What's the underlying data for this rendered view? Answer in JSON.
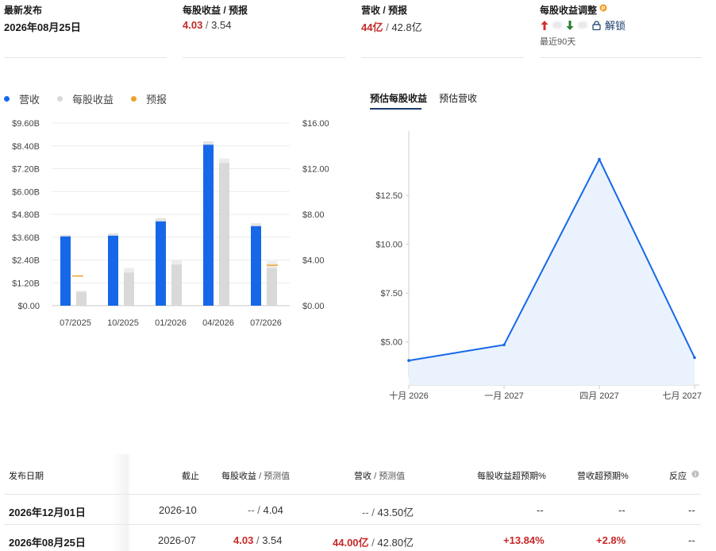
{
  "stats": {
    "latest": {
      "label": "最新发布",
      "value": "2026年08月25日"
    },
    "eps": {
      "label": "每股收益 / 预报",
      "actual": "4.03",
      "sep": " / ",
      "estimate": "3.54"
    },
    "revenue": {
      "label": "营收 / 预报",
      "actual": "44亿",
      "sep": " / ",
      "estimate": "42.8亿"
    },
    "revisions": {
      "label": "每股收益调整",
      "unlock": "解锁",
      "period": "最近90天"
    }
  },
  "legend": {
    "revenue": "营收",
    "eps": "每股收益",
    "forecast": "预报"
  },
  "colors": {
    "revenue": "#1668e8",
    "eps": "#d9d9d9",
    "forecast": "#f0a22e",
    "up": "#d32f2f",
    "down": "#2e7d32",
    "line": "#1668e8",
    "area": "#eaf2fd"
  },
  "tabs": [
    "预估每股收益",
    "预估营收"
  ],
  "chart_data": [
    {
      "type": "bar",
      "categories": [
        "07/2025",
        "10/2025",
        "01/2026",
        "04/2026",
        "07/2026"
      ],
      "left_axis": {
        "ticks": [
          "$0.00",
          "$1.20B",
          "$2.40B",
          "$3.60B",
          "$4.80B",
          "$6.00B",
          "$7.20B",
          "$8.40B",
          "$9.60B"
        ],
        "ylim": [
          0,
          9.6
        ]
      },
      "right_axis": {
        "ticks": [
          "$0.00",
          "$4.00",
          "$8.00",
          "$12.00",
          "$16.00"
        ],
        "ylim": [
          0,
          16
        ]
      },
      "series": [
        {
          "name": "营收",
          "axis": "left",
          "values": [
            3.64,
            3.68,
            4.43,
            8.46,
            4.18
          ],
          "estimates": [
            3.72,
            3.8,
            4.6,
            8.64,
            4.33
          ]
        },
        {
          "name": "每股收益",
          "axis": "right",
          "values": [
            1.2,
            2.9,
            3.6,
            12.5,
            3.3
          ],
          "estimates": [
            1.3,
            3.3,
            4.0,
            12.9,
            3.9
          ]
        },
        {
          "name": "预报",
          "axis": "right",
          "values": [
            2.6,
            null,
            null,
            null,
            3.54
          ]
        }
      ]
    },
    {
      "type": "area",
      "x": [
        "十月 2026",
        "一月 2027",
        "四月 2027",
        "七月 2027"
      ],
      "y": [
        4.05,
        4.85,
        14.35,
        4.2
      ],
      "y_ticks": [
        "$5.00",
        "$7.50",
        "$10.00",
        "$12.50"
      ],
      "ylim": [
        3.2,
        15.8
      ]
    }
  ],
  "table": {
    "headers": {
      "date": "发布日期",
      "period": "截止",
      "eps": "每股收益",
      "eps_est": "预测值",
      "rev": "营收",
      "rev_est": "预测值",
      "eps_surprise": "每股收益超预期%",
      "rev_surprise": "营收超预期%",
      "reaction": "反应"
    },
    "slash": "/",
    "rows": [
      {
        "date": "2026年12月01日",
        "period": "2026-10",
        "eps": "--",
        "eps_est": "4.04",
        "rev": "--",
        "rev_est": "43.50亿",
        "eps_surprise": "--",
        "rev_surprise": "--",
        "reaction": "--"
      },
      {
        "date": "2026年08月25日",
        "period": "2026-07",
        "eps": "4.03",
        "eps_est": "3.54",
        "rev": "44.00亿",
        "rev_est": "42.80亿",
        "eps_surprise": "+13.84%",
        "rev_surprise": "+2.8%",
        "reaction": "--"
      }
    ]
  }
}
